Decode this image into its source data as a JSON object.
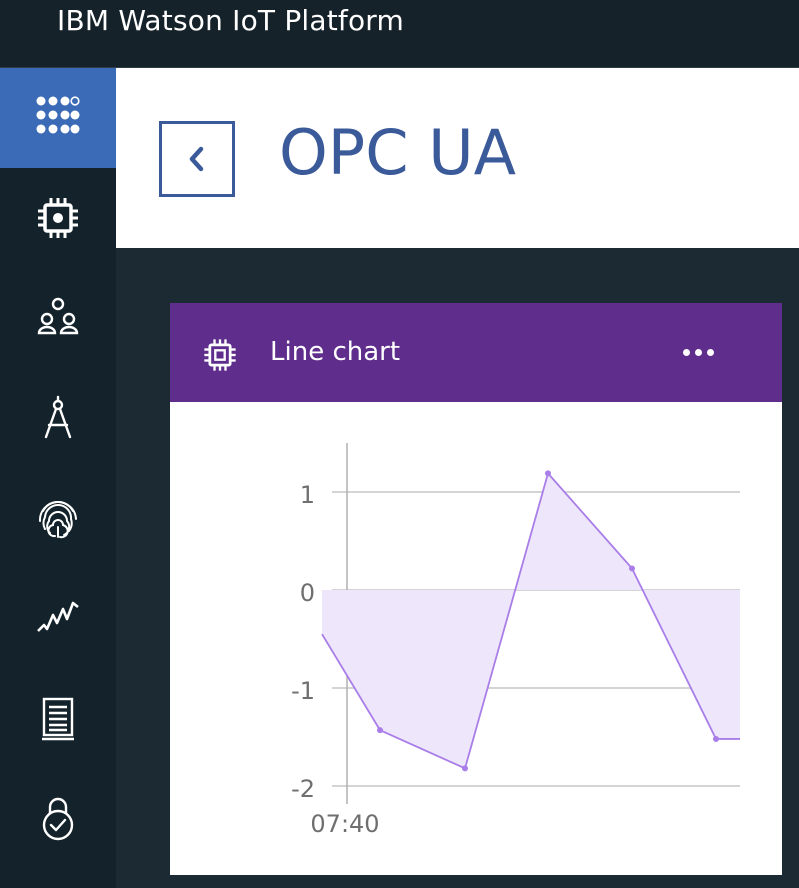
{
  "app": {
    "title": "IBM Watson IoT Platform"
  },
  "sidebar": {
    "items": [
      {
        "icon": "apps-grid-icon",
        "active": true
      },
      {
        "icon": "chip-icon",
        "active": false
      },
      {
        "icon": "members-icon",
        "active": false
      },
      {
        "icon": "compass-icon",
        "active": false
      },
      {
        "icon": "fingerprint-icon",
        "active": false
      },
      {
        "icon": "activity-icon",
        "active": false
      },
      {
        "icon": "document-icon",
        "active": false
      },
      {
        "icon": "lock-check-icon",
        "active": false
      }
    ]
  },
  "header": {
    "back_icon": "chevron-left-icon",
    "title": "OPC UA"
  },
  "card": {
    "icon": "chip-icon",
    "title": "Line chart",
    "menu_icon": "overflow-menu-icon"
  },
  "chart_data": {
    "type": "area",
    "title": "",
    "xlabel": "",
    "ylabel": "",
    "ylim": [
      -2,
      1.5
    ],
    "yticks": [
      1,
      0,
      -1,
      -2
    ],
    "xtick_labels": [
      "07:40"
    ],
    "grid": true,
    "series": [
      {
        "color": "#a97ee8",
        "fill": "#eee6fb",
        "points": [
          {
            "t": 0,
            "y": -0.45
          },
          {
            "t": 1,
            "y": -1.43
          },
          {
            "t": 2,
            "y": -1.82
          },
          {
            "t": 3,
            "y": 1.19
          },
          {
            "t": 4,
            "y": 0.22
          },
          {
            "t": 5,
            "y": -1.52
          },
          {
            "t": 6,
            "y": -1.52
          }
        ]
      }
    ]
  }
}
